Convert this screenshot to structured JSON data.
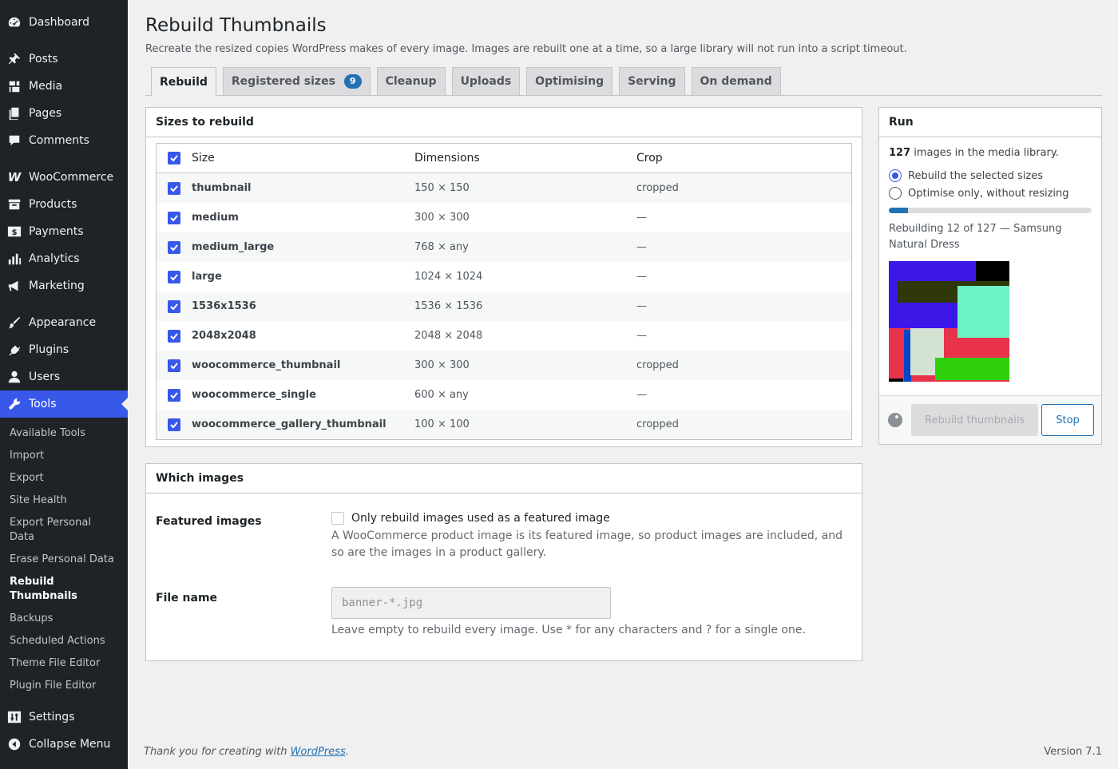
{
  "sidebar": {
    "items": [
      {
        "label": "Dashboard",
        "icon": "dashboard-icon"
      },
      {
        "label": "Posts",
        "icon": "pin-icon"
      },
      {
        "label": "Media",
        "icon": "media-icon"
      },
      {
        "label": "Pages",
        "icon": "pages-icon"
      },
      {
        "label": "Comments",
        "icon": "comment-icon"
      },
      {
        "label": "WooCommerce",
        "icon": "woocommerce-icon"
      },
      {
        "label": "Products",
        "icon": "archive-icon"
      },
      {
        "label": "Payments",
        "icon": "payments-icon"
      },
      {
        "label": "Analytics",
        "icon": "bar-chart-icon"
      },
      {
        "label": "Marketing",
        "icon": "megaphone-icon"
      },
      {
        "label": "Appearance",
        "icon": "brush-icon"
      },
      {
        "label": "Plugins",
        "icon": "plug-icon"
      },
      {
        "label": "Users",
        "icon": "user-icon"
      },
      {
        "label": "Tools",
        "icon": "wrench-icon"
      },
      {
        "label": "Settings",
        "icon": "sliders-icon"
      },
      {
        "label": "Collapse Menu",
        "icon": "collapse-icon"
      }
    ],
    "tools_submenu": [
      "Available Tools",
      "Import",
      "Export",
      "Site Health",
      "Export Personal Data",
      "Erase Personal Data",
      "Rebuild Thumbnails",
      "Backups",
      "Scheduled Actions",
      "Theme File Editor",
      "Plugin File Editor"
    ]
  },
  "page": {
    "title": "Rebuild Thumbnails",
    "description": "Recreate the resized copies WordPress makes of every image. Images are rebuilt one at a time, so a large library will not run into a script timeout."
  },
  "tabs": [
    {
      "label": "Rebuild"
    },
    {
      "label": "Registered sizes",
      "badge": "9"
    },
    {
      "label": "Cleanup"
    },
    {
      "label": "Uploads"
    },
    {
      "label": "Optimising"
    },
    {
      "label": "Serving"
    },
    {
      "label": "On demand"
    }
  ],
  "sizes": {
    "heading": "Sizes to rebuild",
    "columns": {
      "size": "Size",
      "dimensions": "Dimensions",
      "crop": "Crop"
    },
    "rows": [
      {
        "size": "thumbnail",
        "dimensions": "150 × 150",
        "crop": "cropped"
      },
      {
        "size": "medium",
        "dimensions": "300 × 300",
        "crop": "—"
      },
      {
        "size": "medium_large",
        "dimensions": "768 × any",
        "crop": "—"
      },
      {
        "size": "large",
        "dimensions": "1024 × 1024",
        "crop": "—"
      },
      {
        "size": "1536x1536",
        "dimensions": "1536 × 1536",
        "crop": "—"
      },
      {
        "size": "2048x2048",
        "dimensions": "2048 × 2048",
        "crop": "—"
      },
      {
        "size": "woocommerce_thumbnail",
        "dimensions": "300 × 300",
        "crop": "cropped"
      },
      {
        "size": "woocommerce_single",
        "dimensions": "600 × any",
        "crop": "—"
      },
      {
        "size": "woocommerce_gallery_thumbnail",
        "dimensions": "100 × 100",
        "crop": "cropped"
      }
    ]
  },
  "which": {
    "heading": "Which images",
    "featured_label": "Featured images",
    "featured_checkbox": "Only rebuild images used as a featured image",
    "featured_help": "A WooCommerce product image is its featured image, so product images are included, and so are the images in a product gallery.",
    "filename_label": "File name",
    "filename_placeholder": "banner-*.jpg",
    "filename_help": "Leave empty to rebuild every image. Use * for any characters and ? for a single one."
  },
  "run": {
    "heading": "Run",
    "count": "127",
    "count_text": " images in the media library.",
    "option_rebuild": "Rebuild the selected sizes",
    "option_optimise": "Optimise only, without resizing",
    "progress_fraction": 0.0945,
    "status": "Rebuilding 12 of 127 — Samsung Natural Dress",
    "rebuild_button": "Rebuild thumbnails",
    "stop_button": "Stop"
  },
  "footer": {
    "thanks_prefix": "Thank you for creating with ",
    "thanks_link": "WordPress",
    "thanks_suffix": ".",
    "version": "Version 7.1"
  },
  "colors": {
    "accent": "#3858e9",
    "link": "#2271b1",
    "sidebar_bg": "#1d2327"
  }
}
